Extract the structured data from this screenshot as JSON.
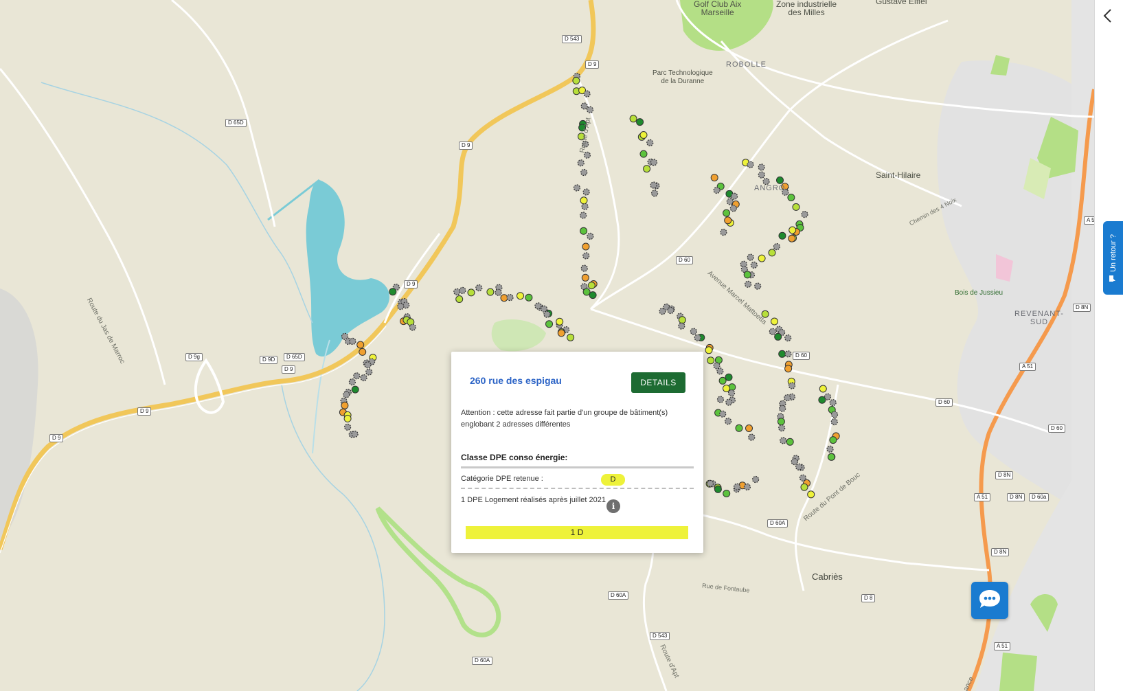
{
  "map": {
    "place_labels": [
      {
        "name": "golf",
        "text": "Golf Club Aix\nMarseille"
      },
      {
        "name": "zone-milles",
        "text": "Zone industrielle\ndes Milles"
      },
      {
        "name": "gustave-eiffel",
        "text": "Gustave Eiffel"
      },
      {
        "name": "parc-technologique",
        "text": "Parc Technologique\nde la Duranne"
      },
      {
        "name": "robolle",
        "text": "ROBOLLE"
      },
      {
        "name": "saint-hilaire",
        "text": "Saint-Hilaire"
      },
      {
        "name": "bois-de-jussieu",
        "text": "Bois de Jussieu"
      },
      {
        "name": "revenant-sud",
        "text": "REVENANT-\nSUD"
      },
      {
        "name": "cabries",
        "text": "Cabriès"
      },
      {
        "name": "angro",
        "text": "ANGRO"
      }
    ],
    "street_labels": [
      {
        "name": "route-du-jas-de-marroc",
        "text": "Route du Jas de Marroc"
      },
      {
        "name": "route-d-apt-north",
        "text": "Route d'Apt"
      },
      {
        "name": "avenue-marcel-mattoetta",
        "text": "Avenue Marcel Mattoetta"
      },
      {
        "name": "chemin-des-4-noix",
        "text": "Chemin des 4 Noix"
      },
      {
        "name": "route-du-pont-de-bouc",
        "text": "Route du Pont de Bouc"
      },
      {
        "name": "rue-de-fontaube",
        "text": "Rue de Fontaube"
      },
      {
        "name": "route-d-apt-south",
        "text": "Route d'Apt"
      },
      {
        "name": "ance",
        "text": "ance"
      }
    ],
    "road_signs": [
      "D 543",
      "D 9",
      "D 65D",
      "D 9",
      "D 9",
      "D 9g",
      "D 9D",
      "D 65D",
      "D 9",
      "D 9",
      "D 9",
      "D 60",
      "D 60",
      "D 60",
      "D 60",
      "D 60A",
      "D 60A",
      "D 543",
      "D 60A",
      "D 8",
      "A 51",
      "A 51",
      "A 51",
      "D 8N",
      "D 8N",
      "D 8N",
      "D 8N",
      "D 60a",
      "A 5"
    ]
  },
  "popup": {
    "address": "260 rue des espigau",
    "details_label": "DETAILS",
    "warning": "Attention : cette adresse fait partie d'un groupe de bâtiment(s) englobant 2 adresses différentes",
    "section_title": "Classe DPE conso énergie:",
    "category_label": "Catégorie DPE retenue :",
    "category_value": "D",
    "dpe_count_text": "1 DPE Logement réalisés après juillet 2021",
    "bar_label": "1  D",
    "category_color": "#eef23a",
    "info_icon": "i"
  },
  "feedback": {
    "label": "Un retour ?",
    "icon": "speech-bubble-icon"
  },
  "chat": {
    "icon": "chat-bubble-icon"
  },
  "sidebar": {
    "collapse_icon": "chevron-left-icon"
  },
  "colors": {
    "primary_button": "#1d6b32",
    "accent_blue": "#1a7bd0",
    "dpe_grey": "#9a9a9a",
    "dpe_green_dark": "#1f8a2e",
    "dpe_green": "#5cc23d",
    "dpe_lightgreen": "#b7df3a",
    "dpe_yellow": "#eef23a",
    "dpe_orange": "#f0a030",
    "dpe_red": "#e02020"
  }
}
